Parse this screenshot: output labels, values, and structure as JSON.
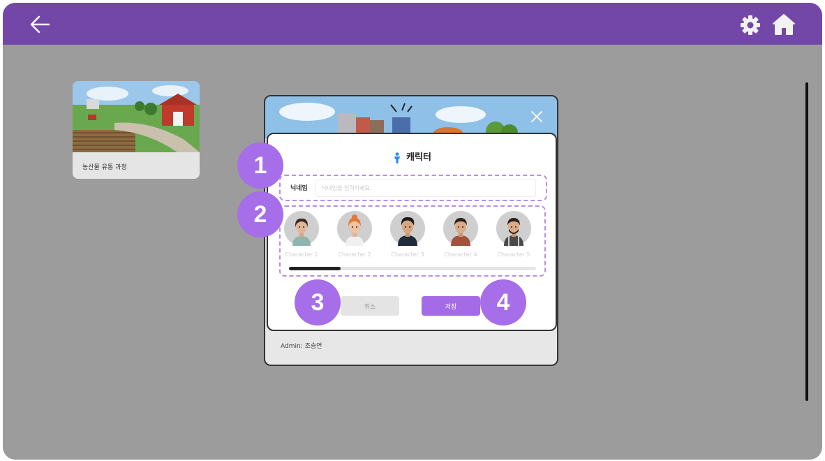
{
  "colors": {
    "header": "#7347a8",
    "accent": "#a56be6",
    "badge": "#a66ee8",
    "overlay": "#9c9c9c"
  },
  "topbar": {
    "back_icon": "arrow-left-icon",
    "settings_icon": "gear-icon",
    "home_icon": "home-icon"
  },
  "course_card": {
    "title": "농산물 유통 과정"
  },
  "background_modal": {
    "admin": "Admin: 조승연",
    "close_icon": "close-icon"
  },
  "dialog": {
    "title": "캐릭터",
    "title_icon": "person-icon",
    "nickname": {
      "label": "닉네임",
      "placeholder": "닉네임을 입력하세요.",
      "value": ""
    },
    "characters": [
      {
        "name": "Character 1"
      },
      {
        "name": "Character 2"
      },
      {
        "name": "Character 3"
      },
      {
        "name": "Character 4"
      },
      {
        "name": "Character 5"
      }
    ],
    "scroll_progress": 0.21,
    "buttons": {
      "cancel": "취소",
      "save": "저장"
    }
  },
  "annotations": [
    "1",
    "2",
    "3",
    "4"
  ]
}
